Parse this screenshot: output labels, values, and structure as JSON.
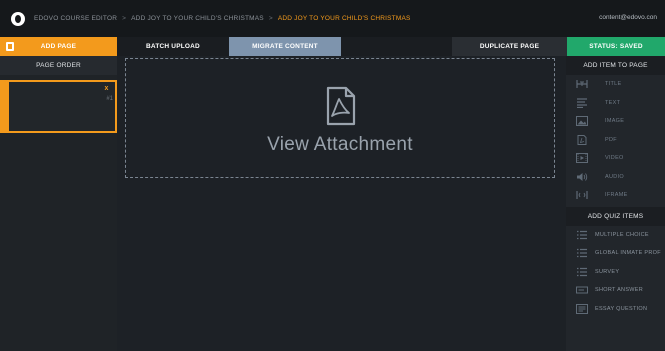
{
  "header": {
    "breadcrumbs": [
      {
        "label": "EDOVO COURSE EDITOR",
        "active": false
      },
      {
        "label": "ADD JOY TO YOUR CHILD'S CHRISTMAS",
        "active": false
      },
      {
        "label": "ADD JOY TO YOUR CHILD'S CHRISTMAS",
        "active": true
      }
    ],
    "separator": ">",
    "user_email": "content@edovo.con"
  },
  "tabs": {
    "add_page": "ADD PAGE",
    "batch_upload": "BATCH UPLOAD",
    "migrate_content": "MIGRATE CONTENT",
    "duplicate_page": "DUPLICATE PAGE",
    "status": "STATUS: SAVED"
  },
  "sidebar": {
    "title": "PAGE ORDER",
    "pages": [
      {
        "close": "x",
        "number": "#1"
      }
    ]
  },
  "main": {
    "attachment_label": "View Attachment"
  },
  "right_panel": {
    "add_item_title": "ADD ITEM TO PAGE",
    "items": [
      {
        "label": "TITLE",
        "icon": "title-icon"
      },
      {
        "label": "TEXT",
        "icon": "text-icon"
      },
      {
        "label": "IMAGE",
        "icon": "image-icon"
      },
      {
        "label": "PDF",
        "icon": "pdf-icon"
      },
      {
        "label": "VIDEO",
        "icon": "video-icon"
      },
      {
        "label": "AUDIO",
        "icon": "audio-icon"
      },
      {
        "label": "IFRAME",
        "icon": "iframe-icon"
      }
    ],
    "quiz_title": "ADD QUIZ ITEMS",
    "quiz_items": [
      {
        "label": "MULTIPLE CHOICE",
        "icon": "list-icon"
      },
      {
        "label": "GLOBAL INMATE PROF",
        "icon": "list-icon"
      },
      {
        "label": "SURVEY",
        "icon": "list-icon"
      },
      {
        "label": "SHORT ANSWER",
        "icon": "short-answer-icon"
      },
      {
        "label": "ESSAY QUESTION",
        "icon": "essay-icon"
      }
    ]
  },
  "colors": {
    "accent_orange": "#f39a1c",
    "status_green": "#21a86b",
    "migrate_blue": "#7e94ad",
    "background": "#1d2126"
  }
}
